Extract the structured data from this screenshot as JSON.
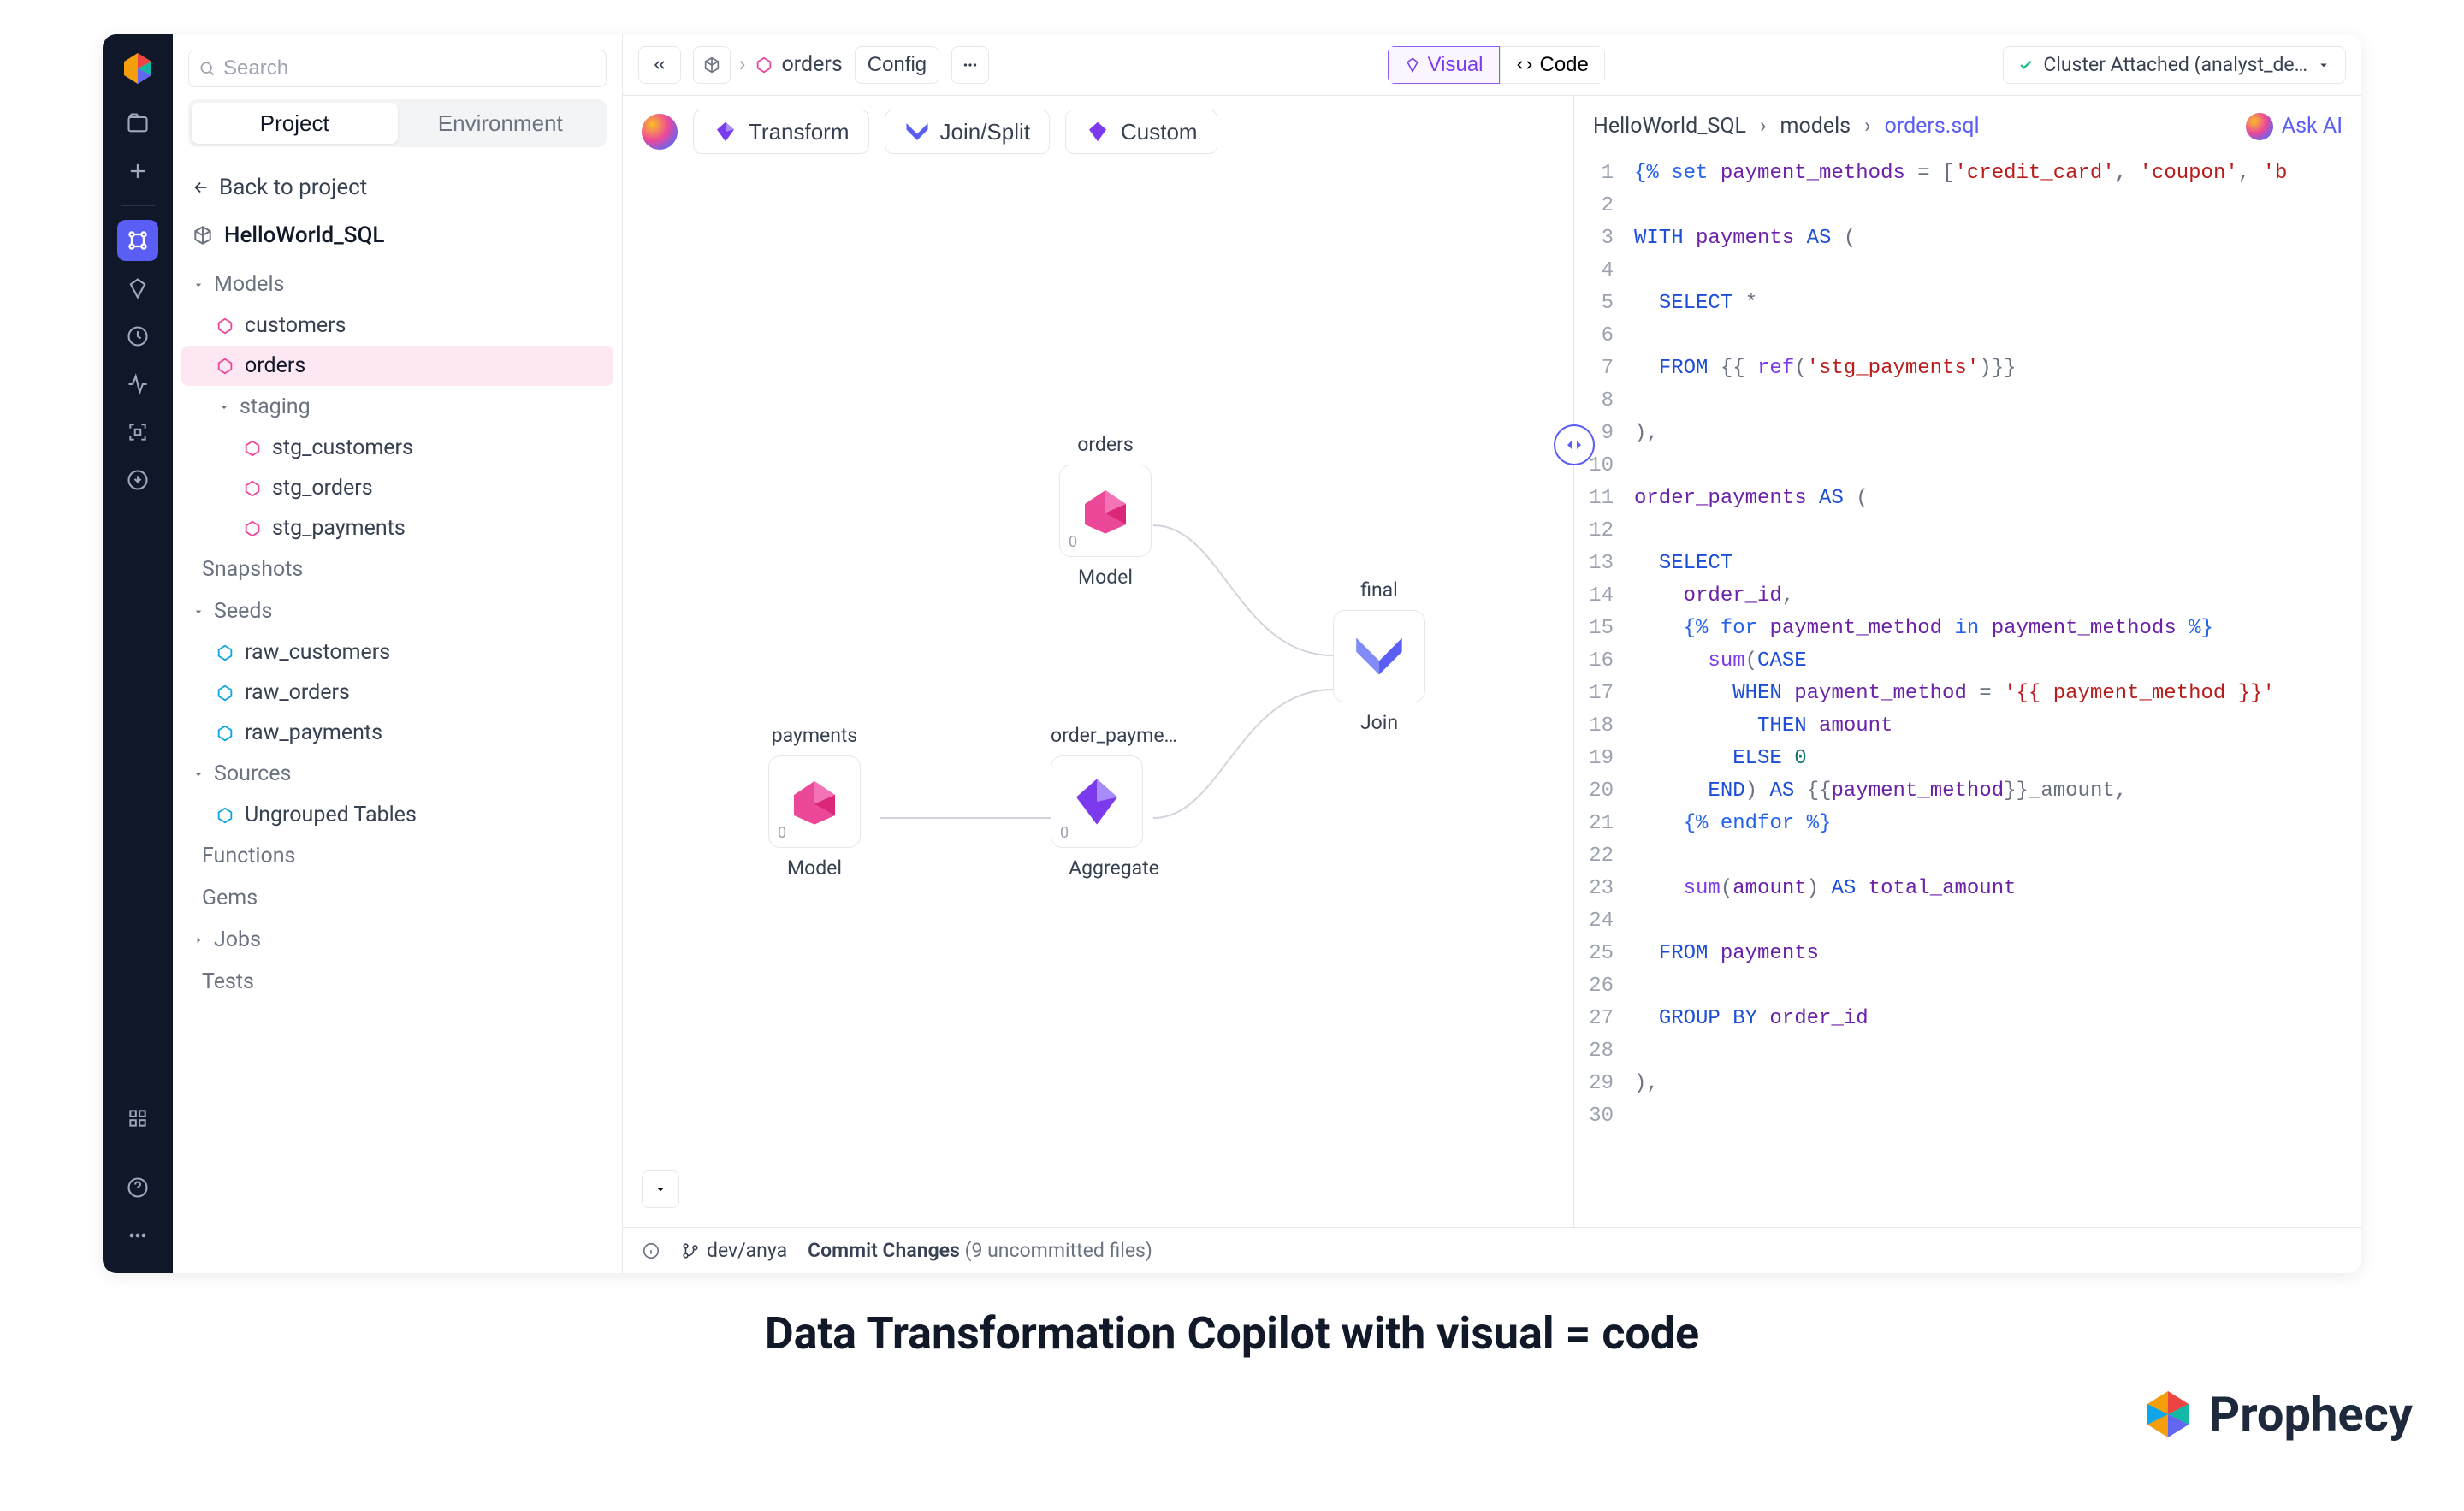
{
  "search": {
    "placeholder": "Search"
  },
  "tabs": {
    "project": "Project",
    "environment": "Environment"
  },
  "back": "Back to project",
  "project_name": "HelloWorld_SQL",
  "tree": {
    "models_label": "Models",
    "models": [
      "customers",
      "orders"
    ],
    "staging_label": "staging",
    "staging": [
      "stg_customers",
      "stg_orders",
      "stg_payments"
    ],
    "snapshots_label": "Snapshots",
    "seeds_label": "Seeds",
    "seeds": [
      "raw_customers",
      "raw_orders",
      "raw_payments"
    ],
    "sources_label": "Sources",
    "sources": [
      "Ungrouped Tables"
    ],
    "functions_label": "Functions",
    "gems_label": "Gems",
    "jobs_label": "Jobs",
    "tests_label": "Tests"
  },
  "topbar": {
    "crumb_model": "orders",
    "config": "Config",
    "visual": "Visual",
    "code": "Code",
    "cluster": "Cluster Attached (analyst_de…"
  },
  "canvas_toolbar": {
    "transform": "Transform",
    "joinsplit": "Join/Split",
    "custom": "Custom"
  },
  "nodes": {
    "orders": {
      "title": "orders",
      "type": "Model",
      "count": "0"
    },
    "payments": {
      "title": "payments",
      "type": "Model",
      "count": "0"
    },
    "order_payments": {
      "title": "order_payme…",
      "type": "Aggregate",
      "count": "0"
    },
    "final": {
      "title": "final",
      "type": "Join"
    }
  },
  "code_crumbs": {
    "root": "HelloWorld_SQL",
    "mid": "models",
    "file": "orders.sql",
    "ask_ai": "Ask AI"
  },
  "code_lines": [
    [
      {
        "t": "tpl",
        "v": "{% "
      },
      {
        "t": "set",
        "v": "set"
      },
      {
        "t": "id",
        "v": " payment_methods "
      },
      {
        "t": "op",
        "v": "= ["
      },
      {
        "t": "str",
        "v": "'credit_card'"
      },
      {
        "t": "op",
        "v": ", "
      },
      {
        "t": "str",
        "v": "'coupon'"
      },
      {
        "t": "op",
        "v": ", "
      },
      {
        "t": "str",
        "v": "'b"
      }
    ],
    [],
    [
      {
        "t": "kw",
        "v": "WITH"
      },
      {
        "t": "id",
        "v": " payments "
      },
      {
        "t": "kw",
        "v": "AS"
      },
      {
        "t": "op",
        "v": " ("
      }
    ],
    [],
    [
      {
        "t": "",
        "v": "  "
      },
      {
        "t": "kw",
        "v": "SELECT"
      },
      {
        "t": "op",
        "v": " *"
      }
    ],
    [],
    [
      {
        "t": "",
        "v": "  "
      },
      {
        "t": "kw",
        "v": "FROM"
      },
      {
        "t": "op",
        "v": " {{ "
      },
      {
        "t": "fn",
        "v": "ref"
      },
      {
        "t": "op",
        "v": "("
      },
      {
        "t": "str",
        "v": "'stg_payments'"
      },
      {
        "t": "op",
        "v": ")}}"
      }
    ],
    [],
    [
      {
        "t": "op",
        "v": "),"
      }
    ],
    [],
    [
      {
        "t": "id",
        "v": "order_payments "
      },
      {
        "t": "kw",
        "v": "AS"
      },
      {
        "t": "op",
        "v": " ("
      }
    ],
    [],
    [
      {
        "t": "",
        "v": "  "
      },
      {
        "t": "kw",
        "v": "SELECT"
      }
    ],
    [
      {
        "t": "",
        "v": "    "
      },
      {
        "t": "id",
        "v": "order_id"
      },
      {
        "t": "op",
        "v": ","
      }
    ],
    [
      {
        "t": "",
        "v": "    "
      },
      {
        "t": "tpl",
        "v": "{% "
      },
      {
        "t": "set",
        "v": "for"
      },
      {
        "t": "id",
        "v": " payment_method "
      },
      {
        "t": "set",
        "v": "in"
      },
      {
        "t": "id",
        "v": " payment_methods "
      },
      {
        "t": "tpl",
        "v": "%}"
      }
    ],
    [
      {
        "t": "",
        "v": "      "
      },
      {
        "t": "fn",
        "v": "sum"
      },
      {
        "t": "op",
        "v": "("
      },
      {
        "t": "kw",
        "v": "CASE"
      }
    ],
    [
      {
        "t": "",
        "v": "        "
      },
      {
        "t": "kw",
        "v": "WHEN"
      },
      {
        "t": "id",
        "v": " payment_method "
      },
      {
        "t": "op",
        "v": "= "
      },
      {
        "t": "str",
        "v": "'{{ payment_method }}'"
      }
    ],
    [
      {
        "t": "",
        "v": "          "
      },
      {
        "t": "kw",
        "v": "THEN"
      },
      {
        "t": "id",
        "v": " amount"
      }
    ],
    [
      {
        "t": "",
        "v": "        "
      },
      {
        "t": "kw",
        "v": "ELSE"
      },
      {
        "t": "num",
        "v": " 0"
      }
    ],
    [
      {
        "t": "",
        "v": "      "
      },
      {
        "t": "kw",
        "v": "END"
      },
      {
        "t": "op",
        "v": ") "
      },
      {
        "t": "kw",
        "v": "AS"
      },
      {
        "t": "op",
        "v": " {{"
      },
      {
        "t": "id",
        "v": "payment_method"
      },
      {
        "t": "op",
        "v": "}}_amount,"
      }
    ],
    [
      {
        "t": "",
        "v": "    "
      },
      {
        "t": "tpl",
        "v": "{% "
      },
      {
        "t": "set",
        "v": "endfor"
      },
      {
        "t": "tpl",
        "v": " %}"
      }
    ],
    [],
    [
      {
        "t": "",
        "v": "    "
      },
      {
        "t": "fn",
        "v": "sum"
      },
      {
        "t": "op",
        "v": "("
      },
      {
        "t": "id",
        "v": "amount"
      },
      {
        "t": "op",
        "v": ") "
      },
      {
        "t": "kw",
        "v": "AS"
      },
      {
        "t": "id",
        "v": " total_amount"
      }
    ],
    [],
    [
      {
        "t": "",
        "v": "  "
      },
      {
        "t": "kw",
        "v": "FROM"
      },
      {
        "t": "id",
        "v": " payments"
      }
    ],
    [],
    [
      {
        "t": "",
        "v": "  "
      },
      {
        "t": "kw",
        "v": "GROUP BY"
      },
      {
        "t": "id",
        "v": " order_id"
      }
    ],
    [],
    [
      {
        "t": "op",
        "v": "),"
      }
    ],
    []
  ],
  "statusbar": {
    "branch": "dev/anya",
    "commit": "Commit Changes",
    "uncommitted": "(9 uncommitted files)"
  },
  "marketing": "Data Transformation Copilot with visual = code",
  "brand": "Prophecy"
}
